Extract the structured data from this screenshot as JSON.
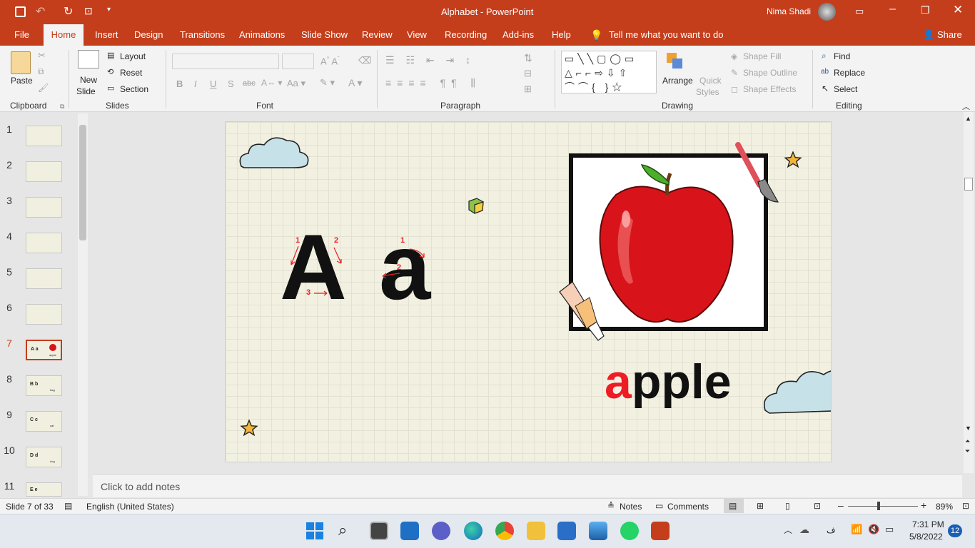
{
  "window": {
    "title": "Alphabet  -  PowerPoint",
    "user": "Nima Shadi"
  },
  "tabs": [
    "File",
    "Home",
    "Insert",
    "Design",
    "Transitions",
    "Animations",
    "Slide Show",
    "Review",
    "View",
    "Recording",
    "Add-ins",
    "Help"
  ],
  "tell_me": "Tell me what you want to do",
  "share": "Share",
  "ribbon": {
    "clipboard": {
      "paste": "Paste",
      "label": "Clipboard"
    },
    "slides": {
      "new_slide_1": "New",
      "new_slide_2": "Slide",
      "layout": "Layout",
      "reset": "Reset",
      "section": "Section",
      "label": "Slides"
    },
    "font": {
      "label": "Font",
      "bold": "B",
      "italic": "I",
      "underline": "U",
      "strike": "S",
      "abc": "abc"
    },
    "paragraph": {
      "label": "Paragraph"
    },
    "drawing": {
      "arrange": "Arrange",
      "quick_1": "Quick",
      "quick_2": "Styles",
      "shape_fill": "Shape Fill",
      "shape_outline": "Shape Outline",
      "shape_effects": "Shape Effects",
      "label": "Drawing"
    },
    "editing": {
      "find": "Find",
      "replace": "Replace",
      "select": "Select",
      "label": "Editing"
    }
  },
  "thumbnails": [
    {
      "num": "1"
    },
    {
      "num": "2"
    },
    {
      "num": "3"
    },
    {
      "num": "4"
    },
    {
      "num": "5"
    },
    {
      "num": "6"
    },
    {
      "num": "7",
      "letters": "A a",
      "word": "apple"
    },
    {
      "num": "8",
      "letters": "B b",
      "word": "bag"
    },
    {
      "num": "9",
      "letters": "C c",
      "word": "cat"
    },
    {
      "num": "10",
      "letters": "D d",
      "word": "dog"
    },
    {
      "num": "11",
      "letters": "E e"
    }
  ],
  "slide": {
    "upper": "A",
    "lower": "a",
    "stroke_labels": [
      "1",
      "2",
      "3",
      "1",
      "2"
    ],
    "word_first": "a",
    "word_rest": "pple",
    "colors": {
      "accent": "#ee1c24",
      "text": "#111111",
      "apple": "#d8141a",
      "cloud": "#c7e1e9",
      "star": "#f2b53a"
    }
  },
  "notes_placeholder": "Click to add notes",
  "status": {
    "slide": "Slide 7 of 33",
    "language": "English (United States)",
    "notes": "Notes",
    "comments": "Comments",
    "zoom": "89%"
  },
  "taskbar": {
    "time": "7:31 PM",
    "date": "5/8/2022",
    "notif": "12"
  }
}
